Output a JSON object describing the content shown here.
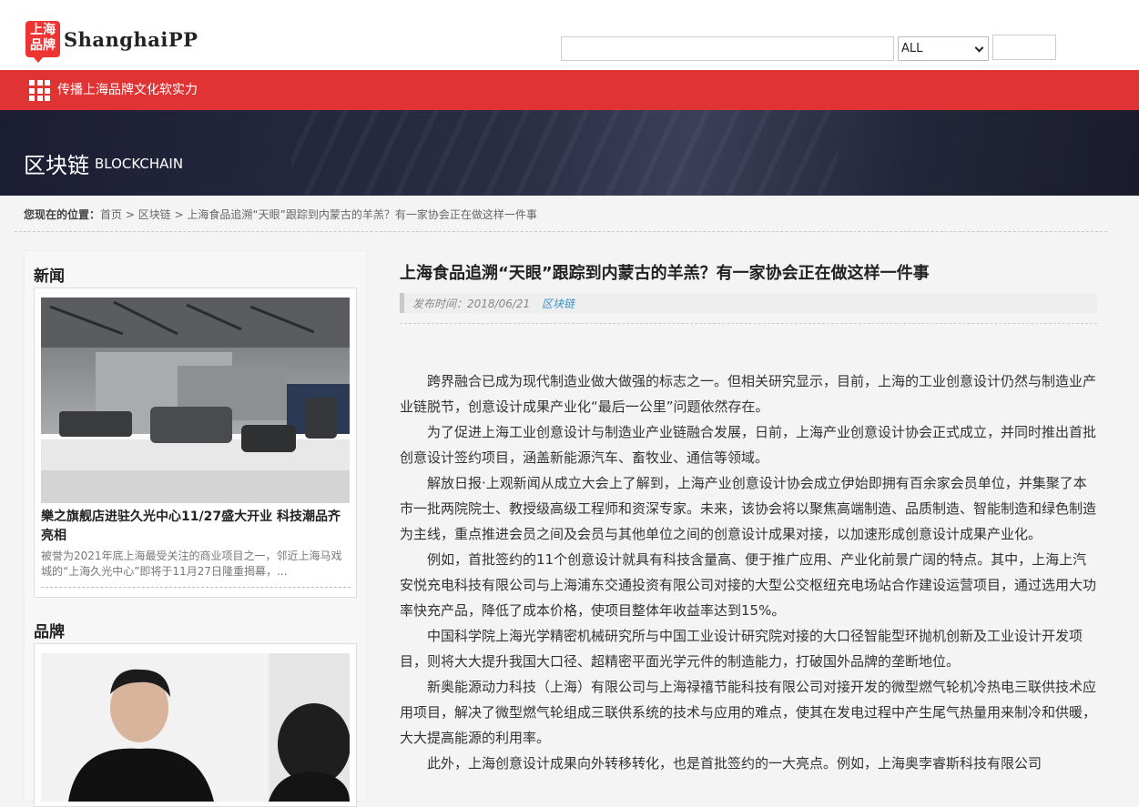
{
  "header": {
    "logo_badge_line1": "上海",
    "logo_badge_line2": "品牌",
    "logo_text": "ShanghaiPP",
    "search_value": "",
    "search_scope": "ALL",
    "search_button_label": ""
  },
  "nav": {
    "slogan": "传播上海品牌文化软实力"
  },
  "banner": {
    "title": "区块链",
    "subtitle": "BLOCKCHAIN"
  },
  "breadcrumb": {
    "label": "您现在的位置：",
    "items": [
      "首页",
      "区块链",
      "上海食品追溯“天眼”跟踪到内蒙古的羊羔？有一家协会正在做这样一件事"
    ],
    "separator": " > "
  },
  "sidebar": {
    "news_heading": "新闻",
    "news_item": {
      "title": "樂之旗舰店进驻久光中心11/27盛大开业 科技潮品齐亮相",
      "desc": "被誉为2021年底上海最受关注的商业项目之一，邻近上海马戏城的“上海久光中心”即将于11月27日隆重揭幕，..."
    },
    "brand_heading": "品牌"
  },
  "article": {
    "title": "上海食品追溯“天眼”跟踪到内蒙古的羊羔？有一家协会正在做这样一件事",
    "date": "发布时间：2018/06/21",
    "category": "区块链",
    "paragraphs": [
      "跨界融合已成为现代制造业做大做强的标志之一。但相关研究显示，目前，上海的工业创意设计仍然与制造业产业链脱节，创意设计成果产业化“最后一公里”问题依然存在。",
      "为了促进上海工业创意设计与制造业产业链融合发展，日前，上海产业创意设计协会正式成立，并同时推出首批创意设计签约项目，涵盖新能源汽车、畜牧业、通信等领域。",
      "解放日报·上观新闻从成立大会上了解到，上海产业创意设计协会成立伊始即拥有百余家会员单位，并集聚了本市一批两院院士、教授级高级工程师和资深专家。未来，该协会将以聚焦高端制造、品质制造、智能制造和绿色制造为主线，重点推进会员之间及会员与其他单位之间的创意设计成果对接，以加速形成创意设计成果产业化。",
      "例如，首批签约的11个创意设计就具有科技含量高、便于推广应用、产业化前景广阔的特点。其中，上海上汽安悦充电科技有限公司与上海浦东交通投资有限公司对接的大型公交枢纽充电场站合作建设运营项目，通过选用大功率快充产品，降低了成本价格，使项目整体年收益率达到15%。",
      "中国科学院上海光学精密机械研究所与中国工业设计研究院对接的大口径智能型环抛机创新及工业设计开发项目，则将大大提升我国大口径、超精密平面光学元件的制造能力，打破国外品牌的垄断地位。",
      "新奥能源动力科技（上海）有限公司与上海禄禧节能科技有限公司对接开发的微型燃气轮机冷热电三联供技术应用项目，解决了微型燃气轮组成三联供系统的技术与应用的难点，使其在发电过程中产生尾气热量用来制冷和供暖，大大提高能源的利用率。",
      "此外，上海创意设计成果向外转移转化，也是首批签约的一大亮点。例如，上海奥孛睿斯科技有限公司"
    ]
  },
  "colors": {
    "nav_red": "#e03334",
    "banner_dark": "#1c1d33",
    "category_link": "#3a8fc8"
  }
}
